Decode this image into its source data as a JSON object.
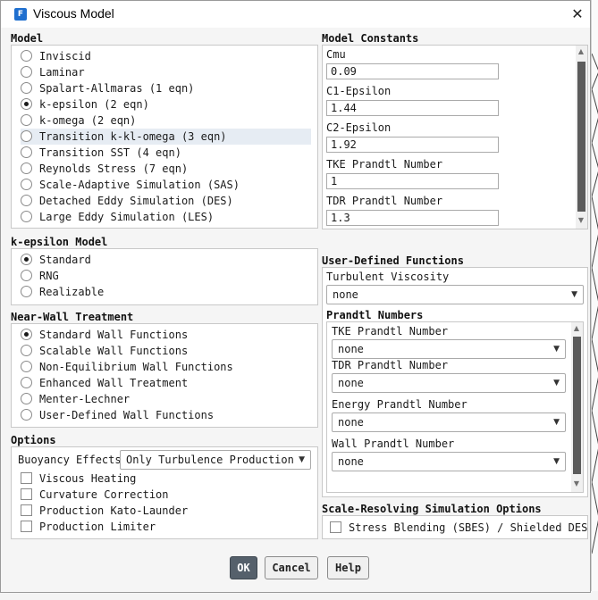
{
  "window": {
    "title": "Viscous Model",
    "app_icon_letter": "F",
    "close_glyph": "✕"
  },
  "model": {
    "heading": "Model",
    "options": [
      {
        "label": "Inviscid",
        "selected": false
      },
      {
        "label": "Laminar",
        "selected": false
      },
      {
        "label": "Spalart-Allmaras (1 eqn)",
        "selected": false
      },
      {
        "label": "k-epsilon (2 eqn)",
        "selected": true
      },
      {
        "label": "k-omega (2 eqn)",
        "selected": false
      },
      {
        "label": "Transition k-kl-omega (3 eqn)",
        "selected": false
      },
      {
        "label": "Transition SST (4 eqn)",
        "selected": false
      },
      {
        "label": "Reynolds Stress (7 eqn)",
        "selected": false
      },
      {
        "label": "Scale-Adaptive Simulation (SAS)",
        "selected": false
      },
      {
        "label": "Detached Eddy Simulation (DES)",
        "selected": false
      },
      {
        "label": "Large Eddy Simulation (LES)",
        "selected": false
      }
    ]
  },
  "constants": {
    "heading": "Model Constants",
    "fields": [
      {
        "label": "Cmu",
        "value": "0.09"
      },
      {
        "label": "C1-Epsilon",
        "value": "1.44"
      },
      {
        "label": "C2-Epsilon",
        "value": "1.92"
      },
      {
        "label": "TKE Prandtl Number",
        "value": "1"
      },
      {
        "label": "TDR Prandtl Number",
        "value": "1.3"
      }
    ]
  },
  "ke_model": {
    "heading": "k-epsilon Model",
    "options": [
      {
        "label": "Standard",
        "selected": true
      },
      {
        "label": "RNG",
        "selected": false
      },
      {
        "label": "Realizable",
        "selected": false
      }
    ]
  },
  "wall": {
    "heading": "Near-Wall Treatment",
    "options": [
      {
        "label": "Standard Wall Functions",
        "selected": true
      },
      {
        "label": "Scalable Wall Functions",
        "selected": false
      },
      {
        "label": "Non-Equilibrium Wall Functions",
        "selected": false
      },
      {
        "label": "Enhanced Wall Treatment",
        "selected": false
      },
      {
        "label": "Menter-Lechner",
        "selected": false
      },
      {
        "label": "User-Defined Wall Functions",
        "selected": false
      }
    ]
  },
  "options": {
    "heading": "Options",
    "buoyancy_label": "Buoyancy Effects",
    "buoyancy_value": "Only Turbulence Production",
    "checks": [
      {
        "label": "Viscous Heating",
        "checked": false
      },
      {
        "label": "Curvature Correction",
        "checked": false
      },
      {
        "label": "Production Kato-Launder",
        "checked": false
      },
      {
        "label": "Production Limiter",
        "checked": false
      }
    ]
  },
  "udf": {
    "heading": "User-Defined Functions",
    "turb_visc_label": "Turbulent Viscosity",
    "turb_visc_value": "none",
    "prandtl_heading": "Prandtl Numbers",
    "prandtl": [
      {
        "label": "TKE Prandtl Number",
        "value": "none"
      },
      {
        "label": "TDR Prandtl Number",
        "value": "none"
      },
      {
        "label": "Energy Prandtl Number",
        "value": "none"
      },
      {
        "label": "Wall Prandtl Number",
        "value": "none"
      }
    ]
  },
  "srs": {
    "heading": "Scale-Resolving Simulation Options",
    "check_label": "Stress Blending (SBES) / Shielded DES",
    "checked": false
  },
  "buttons": {
    "ok": "OK",
    "cancel": "Cancel",
    "help": "Help"
  },
  "colors": {
    "primary_button": "#55606b",
    "highlight_row": "#e6ecf3",
    "scroll_thumb": "#5b5b5b"
  }
}
